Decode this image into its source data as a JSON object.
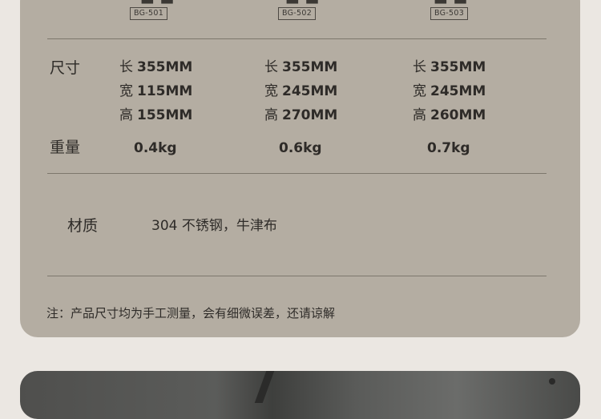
{
  "products": [
    {
      "model": "BG-501",
      "length": "355MM",
      "width": "115MM",
      "height": "155MM",
      "weight": "0.4kg"
    },
    {
      "model": "BG-502",
      "length": "355MM",
      "width": "245MM",
      "height": "270MM",
      "weight": "0.6kg"
    },
    {
      "model": "BG-503",
      "length": "355MM",
      "width": "245MM",
      "height": "260MM",
      "weight": "0.7kg"
    }
  ],
  "labels": {
    "size": "尺寸",
    "weight": "重量",
    "material": "材质",
    "length": "长",
    "width": "宽",
    "height": "高"
  },
  "material_value": "304 不锈钢，牛津布",
  "note": "注：产品尺寸均为手工测量，会有细微误差，还请谅解"
}
